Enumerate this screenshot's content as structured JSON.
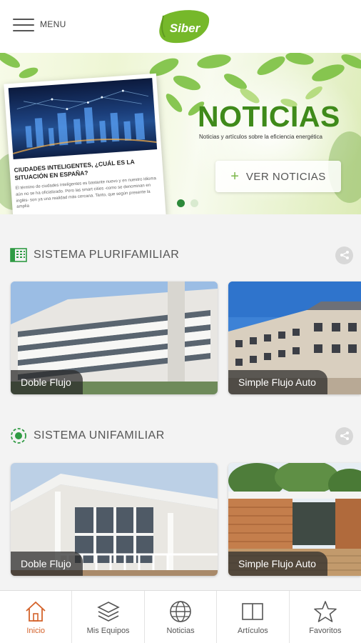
{
  "header": {
    "menu_label": "MENU",
    "logo_text": "Siber",
    "logo_color": "#76b82a"
  },
  "banner": {
    "card_title": "CIUDADES INTELIGENTES, ¿CUÁL ES LA SITUACIÓN EN ESPAÑA?",
    "card_text": "El término de ciudades inteligentes es bastante nuevo y en nuestro idioma aún no se ha oficializado. Pero las smart cities -como se denominan en inglés- son ya una realidad más cercana. Tanto, que según presente la amplia",
    "title": "NOTICIAS",
    "subtitle": "Noticias y artículos sobre la eficiencia energética",
    "button_label": "VER NOTICIAS",
    "slides": 2,
    "active_slide": 1,
    "accent_color": "#3f8a1a"
  },
  "sections": [
    {
      "title": "SISTEMA PLURIFAMILIAR",
      "icon": "building-icon",
      "cards": [
        {
          "label": "Doble Flujo"
        },
        {
          "label": "Simple Flujo Auto"
        }
      ]
    },
    {
      "title": "SISTEMA UNIFAMILIAR",
      "icon": "house-circle-icon",
      "cards": [
        {
          "label": "Doble Flujo"
        },
        {
          "label": "Simple Flujo Auto"
        }
      ]
    }
  ],
  "bottom_nav": {
    "items": [
      {
        "label": "Inicio",
        "icon": "home-icon",
        "active": true
      },
      {
        "label": "Mis Equipos",
        "icon": "layers-icon",
        "active": false
      },
      {
        "label": "Noticias",
        "icon": "globe-icon",
        "active": false
      },
      {
        "label": "Artículos",
        "icon": "book-icon",
        "active": false
      },
      {
        "label": "Favoritos",
        "icon": "star-icon",
        "active": false
      }
    ],
    "active_color": "#d4622a"
  }
}
